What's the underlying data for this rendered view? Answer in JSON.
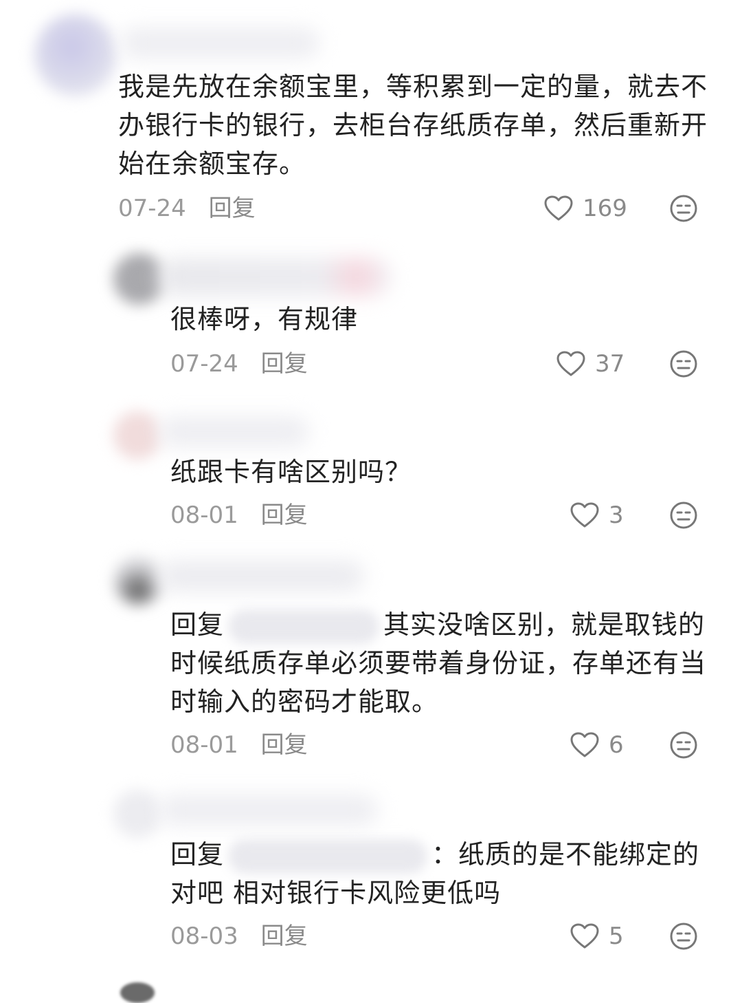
{
  "comments": [
    {
      "text": "我是先放在余额宝里，等积累到一定的量，就去不办银行卡的银行，去柜台存纸质存单，然后重新开始在余额宝存。",
      "date": "07-24",
      "reply_label": "回复",
      "likes": "169"
    },
    {
      "text": "很棒呀，有规律",
      "date": "07-24",
      "reply_label": "回复",
      "likes": "37"
    },
    {
      "text": "纸跟卡有啥区别吗？",
      "date": "08-01",
      "reply_label": "回复",
      "likes": "3"
    },
    {
      "reply_prefix": "回复",
      "text": "其实没啥区别，就是取钱的时候纸质存单必须要带着身份证，存单还有当时输入的密码才能取。",
      "date": "08-01",
      "reply_label": "回复",
      "likes": "6"
    },
    {
      "reply_prefix": "回复",
      "text": "：纸质的是不能绑定的对吧 相对银行卡风险更低吗",
      "date": "08-03",
      "reply_label": "回复",
      "likes": "5"
    }
  ],
  "icons": {
    "like": "heart-outline-icon",
    "emoji": "neutral-face-icon"
  },
  "colors": {
    "meta_text": "#9a9a9a",
    "icon_stroke": "#777777"
  }
}
